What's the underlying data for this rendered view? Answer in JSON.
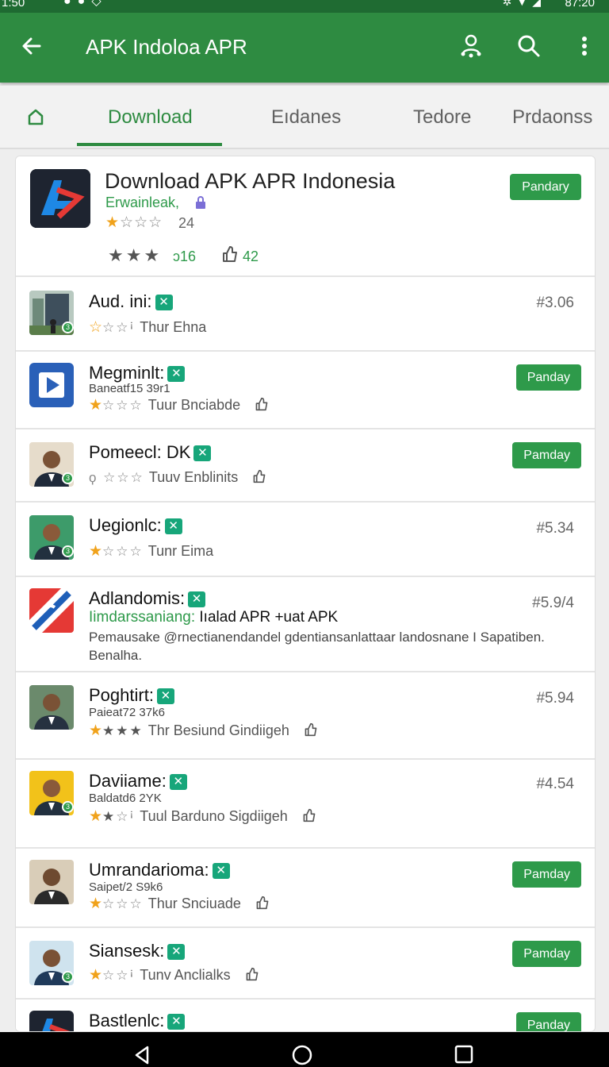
{
  "status_bar": {
    "time": "1:50",
    "battery": "87:20"
  },
  "app_bar": {
    "title": "APK Indoloa APR",
    "icons": [
      "back-arrow-icon",
      "person-network-icon",
      "search-icon",
      "more-vert-icon"
    ]
  },
  "tabs": {
    "items": [
      {
        "label": "Download",
        "active": true
      },
      {
        "label": "Eıdanes",
        "active": false
      },
      {
        "label": "Tedore",
        "active": false
      },
      {
        "label": "Prdaonss",
        "active": false
      }
    ]
  },
  "featured": {
    "title": "Download APK APR Indonesia",
    "developer": "Erwainleak,",
    "rating": "24",
    "count": "ɔ16",
    "likes": "42",
    "button": "Pandary",
    "icon_colors": [
      "#1e2430",
      "#e53935",
      "#1e88e5"
    ]
  },
  "apps": [
    {
      "name": "Aud. ini:",
      "rating_text": "Thur Ehna",
      "rank": "#3.06"
    },
    {
      "name": "Megminlt:",
      "sub": "Baneatf15 39r1",
      "rating_text": "Tuur Bnciabde",
      "button": "Panday"
    },
    {
      "name": "Pomeecl: DK",
      "rating_text": "Tuuv Enblinits",
      "button": "Pamday"
    },
    {
      "name": "Uegionlc:",
      "rating_text": "Tunr Eima",
      "rank": "#5.34"
    },
    {
      "name": "Adlandomis:",
      "green_line_a": "Iimdarssaniang:",
      "green_line_b": "Iıalad APR +uat APK",
      "desc": "Pemausake @rnectianendandel gdentiansanlattaar landosnane I Sapatiben. Benalha.",
      "rank": "#5.9/4"
    },
    {
      "name": "Poghtirt:",
      "sub": "Paieat72 37k6",
      "rating_text": "Thr Besiund Gindiigeh",
      "rank": "#5.94"
    },
    {
      "name": "Daviiame:",
      "sub": "Baldatd6 2YK",
      "rating_text": "Tuul Barduno Sigdiigeh",
      "rank": "#4.54"
    },
    {
      "name": "Umrandarioma:",
      "sub": "Saipet/2 S9k6",
      "rating_text": "Thur Snciuade",
      "button": "Pamday"
    },
    {
      "name": "Siansesk:",
      "rating_text": "Tunv Anclialks",
      "button": "Pamday"
    },
    {
      "name": "Bastlenlc:",
      "button": "Panday"
    }
  ],
  "colors": {
    "app_bar": "#2e8b41",
    "status_bar": "#1f6b32",
    "accent": "#2e9a4a",
    "star": "#f0a21b",
    "badge": "#17a67a"
  }
}
